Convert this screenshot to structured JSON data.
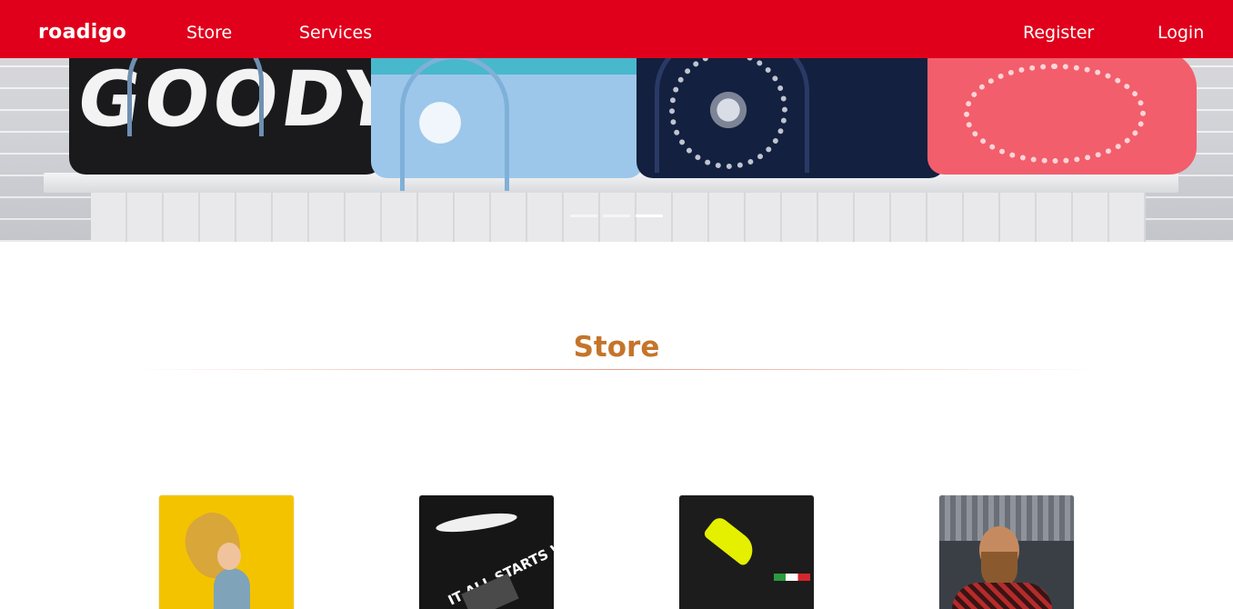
{
  "navbar": {
    "brand": "roadigo",
    "links": {
      "store": "Store",
      "services": "Services",
      "register": "Register",
      "login": "Login"
    },
    "background_color": "#e0001b"
  },
  "hero": {
    "bag_text": "GOODY",
    "carousel": {
      "slides": 3,
      "active_index": 3
    }
  },
  "section": {
    "title": "Store",
    "title_color": "#c5742a"
  },
  "products": [
    {
      "image": "girl-with-headphones-photo"
    },
    {
      "image": "black-tshirt-photo",
      "print_text": "IT ALL STARTS WITH A DREAM"
    },
    {
      "image": "black-tshirt-yellow-car-photo"
    },
    {
      "image": "bearded-man-sunglasses-photo"
    }
  ]
}
